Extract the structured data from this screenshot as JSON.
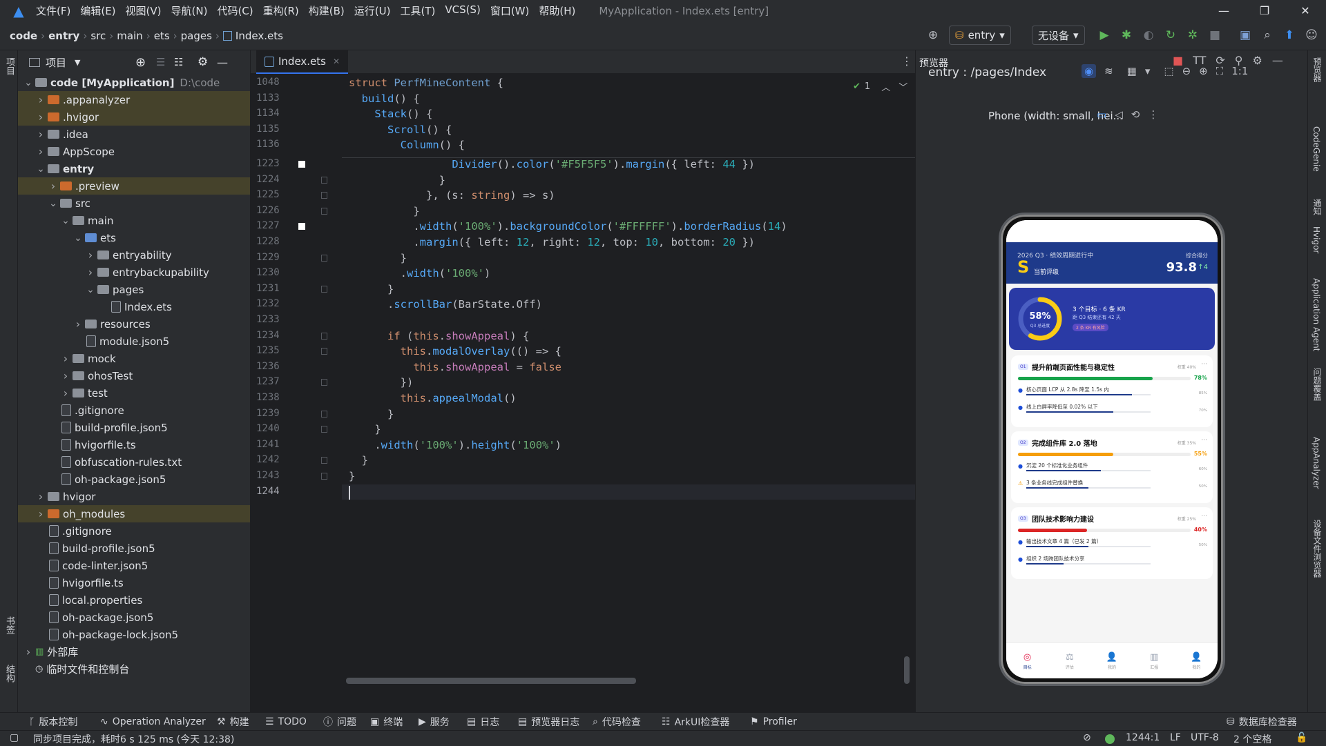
{
  "menu": [
    "文件(F)",
    "编辑(E)",
    "视图(V)",
    "导航(N)",
    "代码(C)",
    "重构(R)",
    "构建(B)",
    "运行(U)",
    "工具(T)",
    "VCS(S)",
    "窗口(W)",
    "帮助(H)"
  ],
  "window_title": "MyApplication - Index.ets [entry]",
  "breadcrumb": [
    "code",
    "entry",
    "src",
    "main",
    "ets",
    "pages",
    "Index.ets"
  ],
  "toolbar": {
    "module": "entry",
    "device": "无设备"
  },
  "left_strip": {
    "project": "项目",
    "bookmarks": "书签",
    "structure": "结构"
  },
  "right_strip": [
    "预览器",
    "CodeGenie",
    "通知",
    "Hvigor",
    "Application Agent",
    "问题覆盖",
    "AppAnalyzer",
    "设备文件浏览器"
  ],
  "project_panel": {
    "title": "项目",
    "tree": [
      {
        "label": "code [MyApplication]",
        "path": "D:\\code",
        "indent": 0,
        "open": true,
        "type": "root"
      },
      {
        "label": ".appanalyzer",
        "indent": 1,
        "open": false,
        "type": "folder-orange",
        "hl": true
      },
      {
        "label": ".hvigor",
        "indent": 1,
        "open": false,
        "type": "folder-orange",
        "hl": true
      },
      {
        "label": ".idea",
        "indent": 1,
        "open": false,
        "type": "folder"
      },
      {
        "label": "AppScope",
        "indent": 1,
        "open": false,
        "type": "folder"
      },
      {
        "label": "entry",
        "indent": 1,
        "open": true,
        "type": "folder-bold"
      },
      {
        "label": ".preview",
        "indent": 2,
        "open": false,
        "type": "folder-orange",
        "hl": true
      },
      {
        "label": "src",
        "indent": 2,
        "open": true,
        "type": "folder"
      },
      {
        "label": "main",
        "indent": 3,
        "open": true,
        "type": "folder"
      },
      {
        "label": "ets",
        "indent": 4,
        "open": true,
        "type": "folder-blue"
      },
      {
        "label": "entryability",
        "indent": 5,
        "open": false,
        "type": "folder"
      },
      {
        "label": "entrybackupability",
        "indent": 5,
        "open": false,
        "type": "folder"
      },
      {
        "label": "pages",
        "indent": 5,
        "open": true,
        "type": "folder"
      },
      {
        "label": "Index.ets",
        "indent": 6,
        "type": "file"
      },
      {
        "label": "resources",
        "indent": 4,
        "open": false,
        "type": "folder"
      },
      {
        "label": "module.json5",
        "indent": 4,
        "type": "file"
      },
      {
        "label": "mock",
        "indent": 3,
        "open": false,
        "type": "folder"
      },
      {
        "label": "ohosTest",
        "indent": 3,
        "open": false,
        "type": "folder"
      },
      {
        "label": "test",
        "indent": 3,
        "open": false,
        "type": "folder"
      },
      {
        "label": ".gitignore",
        "indent": 2,
        "type": "file"
      },
      {
        "label": "build-profile.json5",
        "indent": 2,
        "type": "file"
      },
      {
        "label": "hvigorfile.ts",
        "indent": 2,
        "type": "file"
      },
      {
        "label": "obfuscation-rules.txt",
        "indent": 2,
        "type": "file"
      },
      {
        "label": "oh-package.json5",
        "indent": 2,
        "type": "file"
      },
      {
        "label": "hvigor",
        "indent": 1,
        "open": false,
        "type": "folder"
      },
      {
        "label": "oh_modules",
        "indent": 1,
        "open": false,
        "type": "folder-orange",
        "hl": true
      },
      {
        "label": ".gitignore",
        "indent": 1,
        "type": "file"
      },
      {
        "label": "build-profile.json5",
        "indent": 1,
        "type": "file"
      },
      {
        "label": "code-linter.json5",
        "indent": 1,
        "type": "file"
      },
      {
        "label": "hvigorfile.ts",
        "indent": 1,
        "type": "file"
      },
      {
        "label": "local.properties",
        "indent": 1,
        "type": "file"
      },
      {
        "label": "oh-package.json5",
        "indent": 1,
        "type": "file"
      },
      {
        "label": "oh-package-lock.json5",
        "indent": 1,
        "type": "file"
      },
      {
        "label": "外部库",
        "indent": 0,
        "open": false,
        "type": "lib"
      },
      {
        "label": "临时文件和控制台",
        "indent": 0,
        "type": "scratch"
      }
    ]
  },
  "editor": {
    "tab": "Index.ets",
    "problems": "1",
    "sticky": [
      {
        "ln": "1048",
        "html": "<span class='kw'>struct</span> <span class='cls'>PerfMineContent</span> {"
      },
      {
        "ln": "1133",
        "html": "  <span class='fn'>build</span>() {"
      },
      {
        "ln": "1134",
        "html": "    <span class='fn'>Stack</span>() {"
      },
      {
        "ln": "1135",
        "html": "      <span class='fn'>Scroll</span>() {"
      },
      {
        "ln": "1136",
        "html": "        <span class='fn'>Column</span>() {"
      }
    ],
    "lines": [
      {
        "ln": "1223",
        "html": "                <span class='fn'>Divider</span>().<span class='fn'>color</span>(<span class='st'>'#F5F5F5'</span>).<span class='fn'>margin</span>({ left: <span class='nu'>44</span> })"
      },
      {
        "ln": "1224",
        "html": "              }"
      },
      {
        "ln": "1225",
        "html": "            }, (s: <span class='kw'>string</span>) => s)"
      },
      {
        "ln": "1226",
        "html": "          }"
      },
      {
        "ln": "1227",
        "html": "          .<span class='fn'>width</span>(<span class='st'>'100%'</span>).<span class='fn'>backgroundColor</span>(<span class='st'>'#FFFFFF'</span>).<span class='fn'>borderRadius</span>(<span class='nu'>14</span>)"
      },
      {
        "ln": "1228",
        "html": "          .<span class='fn'>margin</span>({ left: <span class='nu'>12</span>, right: <span class='nu'>12</span>, top: <span class='nu'>10</span>, bottom: <span class='nu'>20</span> })"
      },
      {
        "ln": "1229",
        "html": "        }"
      },
      {
        "ln": "1230",
        "html": "        .<span class='fn'>width</span>(<span class='st'>'100%'</span>)"
      },
      {
        "ln": "1231",
        "html": "      }"
      },
      {
        "ln": "1232",
        "html": "      .<span class='fn'>scrollBar</span>(BarState.Off)"
      },
      {
        "ln": "1233",
        "html": ""
      },
      {
        "ln": "1234",
        "html": "      <span class='kw'>if</span> (<span class='kw'>this</span>.<span class='pr'>showAppeal</span>) {"
      },
      {
        "ln": "1235",
        "html": "        <span class='kw'>this</span>.<span class='fn'>modalOverlay</span>(() => {"
      },
      {
        "ln": "1236",
        "html": "          <span class='kw'>this</span>.<span class='pr'>showAppeal</span> = <span class='kw'>false</span>"
      },
      {
        "ln": "1237",
        "html": "        })"
      },
      {
        "ln": "1238",
        "html": "        <span class='kw'>this</span>.<span class='fn'>appealModal</span>()"
      },
      {
        "ln": "1239",
        "html": "      }"
      },
      {
        "ln": "1240",
        "html": "    }"
      },
      {
        "ln": "1241",
        "html": "    .<span class='fn'>width</span>(<span class='st'>'100%'</span>).<span class='fn'>height</span>(<span class='st'>'100%'</span>)"
      },
      {
        "ln": "1242",
        "html": "  }"
      },
      {
        "ln": "1243",
        "html": "}"
      },
      {
        "ln": "1244",
        "html": ""
      }
    ]
  },
  "preview": {
    "title": "预览器",
    "route": "entry : /pages/Index",
    "device": "Phone (width: small, hei...",
    "app": {
      "header_sub": "2026 Q3 · 绩效周期进行中",
      "grade": "S",
      "grade_label": "当前评级",
      "score_label": "综合得分",
      "score": "93.8",
      "delta": "↑4",
      "ring_pct": "58%",
      "ring_label": "Q3 总进度",
      "ring_value": 0.58,
      "summary1": "3 个目标 · 6 条 KR",
      "summary2": "距 Q3 结束还有 42 天",
      "summary_tag": "2 条 KR 有风险",
      "okrs": [
        {
          "tag": "O1",
          "title": "提升前端页面性能与稳定性",
          "weight": "权重 40%",
          "pct": "78%",
          "value": 0.78,
          "color": "#16a34a",
          "krs": [
            {
              "text": "核心页面 LCP 从 2.8s 降至 1.5s 内",
              "pct": "85%",
              "value": 0.85,
              "warn": false
            },
            {
              "text": "线上白屏率降低至 0.02% 以下",
              "pct": "70%",
              "value": 0.7,
              "warn": false
            }
          ]
        },
        {
          "tag": "O2",
          "title": "完成组件库 2.0 落地",
          "weight": "权重 35%",
          "pct": "55%",
          "value": 0.55,
          "color": "#f59e0b",
          "krs": [
            {
              "text": "沉淀 20 个标准化业务组件",
              "pct": "60%",
              "value": 0.6,
              "warn": false
            },
            {
              "text": "3 条业务线完成组件替换",
              "pct": "50%",
              "value": 0.5,
              "warn": true
            }
          ]
        },
        {
          "tag": "O3",
          "title": "团队技术影响力建设",
          "weight": "权重 25%",
          "pct": "40%",
          "value": 0.4,
          "color": "#dc2626",
          "krs": [
            {
              "text": "输出技术文章 4 篇（已发 2 篇）",
              "pct": "50%",
              "value": 0.5,
              "warn": false
            },
            {
              "text": "组织 2 场跨团队技术分享",
              "pct": "",
              "value": 0.3,
              "warn": false
            }
          ]
        }
      ],
      "nav": [
        {
          "label": "目标",
          "active": true
        },
        {
          "label": "评估",
          "active": false
        },
        {
          "label": "我的",
          "active": false
        },
        {
          "label": "汇报",
          "active": false
        },
        {
          "label": "我的",
          "active": false
        }
      ]
    }
  },
  "toolwindows": [
    "版本控制",
    "Operation Analyzer",
    "构建",
    "TODO",
    "问题",
    "终端",
    "服务",
    "日志",
    "预览器日志",
    "代码检查",
    "ArkUI检查器",
    "Profiler"
  ],
  "db_inspector": "数据库检查器",
  "status": {
    "message": "同步项目完成，耗时6 s 125 ms (今天 12:38)",
    "position": "1244:1",
    "line_sep": "LF",
    "encoding": "UTF-8",
    "indent": "2 个空格"
  },
  "colors": {
    "accent": "#3574f0",
    "app_header": "#1e3a8a",
    "ring": "#facc15"
  }
}
